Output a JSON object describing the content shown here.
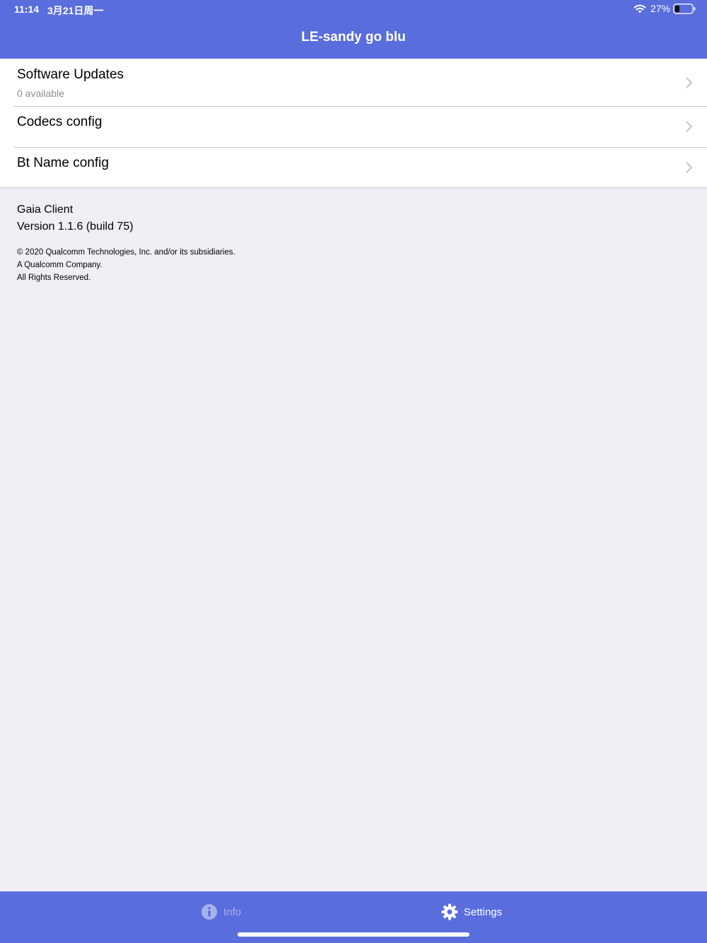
{
  "status_bar": {
    "time": "11:14",
    "date": "3月21日周一",
    "battery_percent": "27%",
    "battery_level": 0.27,
    "icons": [
      "wifi-icon",
      "battery-icon"
    ]
  },
  "nav": {
    "title": "LE-sandy go blu"
  },
  "settings_list": [
    {
      "title": "Software Updates",
      "subtitle": "0 available",
      "icon": "chevron-right-icon"
    },
    {
      "title": "Codecs config",
      "icon": "chevron-right-icon"
    },
    {
      "title": "Bt Name config",
      "icon": "chevron-right-icon"
    }
  ],
  "about": {
    "app_name": "Gaia Client",
    "version": "Version 1.1.6 (build 75)",
    "copyright_lines": [
      "© 2020 Qualcomm Technologies, Inc. and/or its subsidiaries.",
      "A Qualcomm Company.",
      "All Rights Reserved."
    ]
  },
  "tab_bar": {
    "tabs": [
      {
        "label": "Info",
        "icon": "info-icon",
        "selected": false
      },
      {
        "label": "Settings",
        "icon": "gear-icon",
        "selected": true
      }
    ]
  },
  "colors": {
    "accent": "#5a6ddd",
    "background": "#f0eff5",
    "separator": "#c8c7cc",
    "secondary_text": "#8e8e93",
    "inactive_tab": "#a8b1ec"
  }
}
